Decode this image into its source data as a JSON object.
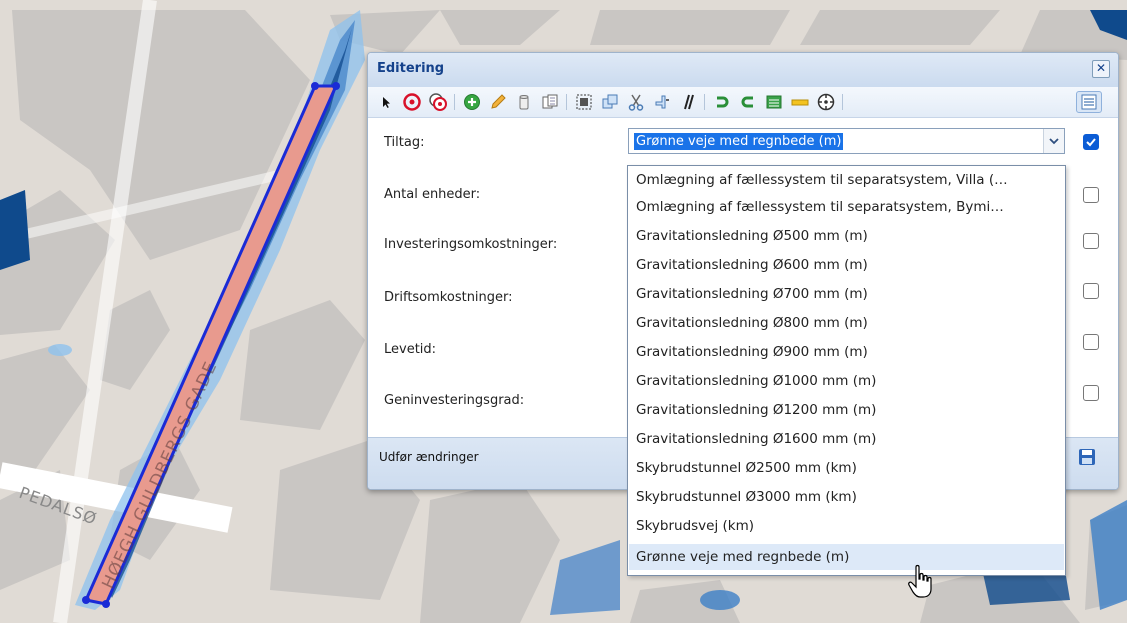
{
  "map": {
    "street_label": "HØEGH GULDBERGS GADE",
    "side_street_label": "PEDALSØ",
    "colors": {
      "background": "#e0dbd5",
      "building": "#c9c6c3",
      "road": "#ffffff",
      "flood_dark": "#0f4a8c",
      "flood_light": "#8ec2ee",
      "selection_fill": "#e89a8e",
      "selection_stroke": "#1a2bd6"
    }
  },
  "panel": {
    "title": "Editering",
    "close_label": "✕",
    "toolbar": [
      "pointer-icon",
      "remove-target-icon",
      "remove-multi-target-icon",
      "add-icon",
      "pencil-icon",
      "delete-icon",
      "copy-icon",
      "select-area-icon",
      "union-icon",
      "cut-icon",
      "reshape-icon",
      "parallel-icon",
      "undo-icon",
      "redo-icon",
      "attribute-table-icon",
      "measure-icon",
      "snap-icon",
      "properties-icon"
    ],
    "fields": [
      {
        "label": "Tiltag:",
        "checked": true
      },
      {
        "label": "Antal enheder:",
        "checked": false
      },
      {
        "label": "Investeringsomkostninger:",
        "checked": false
      },
      {
        "label": "Driftsomkostninger:",
        "checked": false
      },
      {
        "label": "Levetid:",
        "checked": false
      },
      {
        "label": "Geninvesteringsgrad:",
        "checked": false
      }
    ],
    "select_value": "Grønne veje med regnbede (m)",
    "footer_label": "Udfør ændringer"
  },
  "dropdown": {
    "options": [
      "Omlægning af fællessystem til separatsystem, Villa (…",
      "Omlægning af fællessystem til separatsystem, Bymi…",
      "Gravitationsledning Ø500 mm (m)",
      "Gravitationsledning Ø600 mm (m)",
      "Gravitationsledning Ø700 mm (m)",
      "Gravitationsledning Ø800 mm (m)",
      "Gravitationsledning Ø900 mm (m)",
      "Gravitationsledning Ø1000 mm (m)",
      "Gravitationsledning Ø1200 mm (m)",
      "Gravitationsledning Ø1600 mm (m)",
      "Skybrudstunnel Ø2500 mm (km)",
      "Skybrudstunnel Ø3000 mm (km)",
      "Skybrudsvej (km)",
      "Grønne veje med regnbede (m)"
    ],
    "hovered_index": 13
  }
}
